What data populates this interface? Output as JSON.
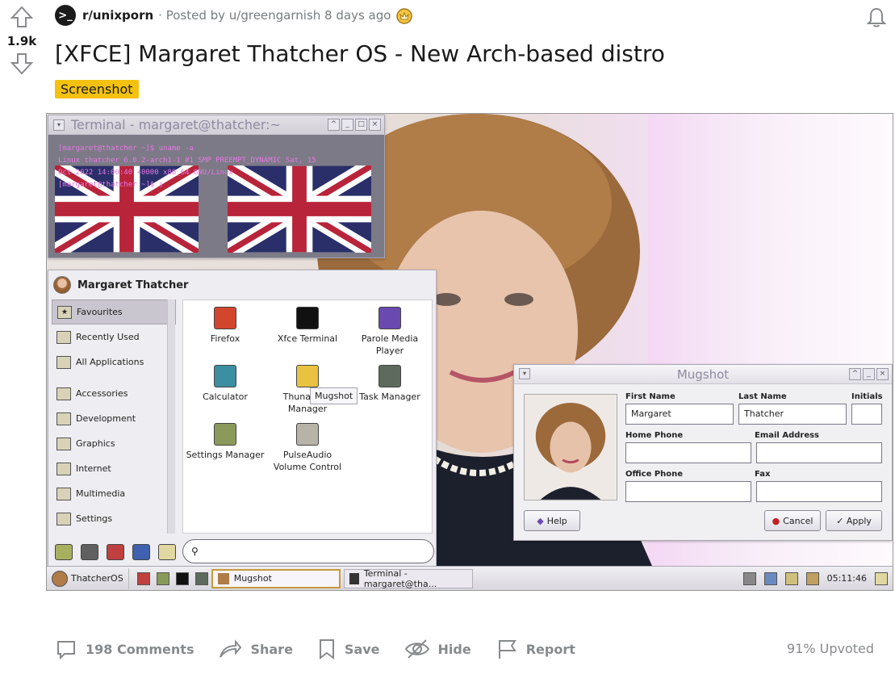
{
  "post": {
    "vote_count": "1.9k",
    "subreddit": "r/unixporn",
    "subreddit_icon": "terminal-prompt",
    "posted_by": "· Posted by u/greengarnish 8 days ago",
    "title": "[XFCE] Margaret Thatcher OS - New Arch-based distro",
    "flair": "Screenshot",
    "flair_color": "#f3c110"
  },
  "screenshot": {
    "terminal": {
      "title": "Terminal - margaret@thatcher:~",
      "lines": [
        "[margaret@thatcher ~]$ uname -a",
        "Linux thatcher 6.0.2-arch1-1 #1 SMP PREEMPT_DYNAMIC Sat, 15",
        "Oct 2022 14:00:40 +0000 x86_64 GNU/Linux",
        "[margaret@thatcher ~]$ ▯"
      ]
    },
    "menu": {
      "user": "Margaret Thatcher",
      "categories": [
        "Favourites",
        "Recently Used",
        "All Applications",
        "Accessories",
        "Development",
        "Graphics",
        "Internet",
        "Multimedia",
        "Settings"
      ],
      "apps": [
        "Firefox",
        "Xfce Terminal",
        "Parole Media Player",
        "Calculator",
        "Thunar File Manager",
        "Task Manager",
        "Settings Manager",
        "PulseAudio Volume Control"
      ],
      "tooltip": "Mugshot"
    },
    "mugshot": {
      "title": "Mugshot",
      "first_name_label": "First Name",
      "first_name": "Margaret",
      "last_name_label": "Last Name",
      "last_name": "Thatcher",
      "initials_label": "Initials",
      "initials": "",
      "home_phone_label": "Home Phone",
      "email_label": "Email Address",
      "office_phone_label": "Office Phone",
      "fax_label": "Fax",
      "help": "Help",
      "cancel": "Cancel",
      "apply": "✓ Apply"
    },
    "taskbar": {
      "start": "ThatcherOS",
      "tasks": [
        "Mugshot",
        "Terminal - margaret@tha..."
      ],
      "clock": "05:11:46"
    }
  },
  "actions": {
    "comments": "198 Comments",
    "share": "Share",
    "save": "Save",
    "hide": "Hide",
    "report": "Report",
    "upvoted": "91% Upvoted"
  }
}
